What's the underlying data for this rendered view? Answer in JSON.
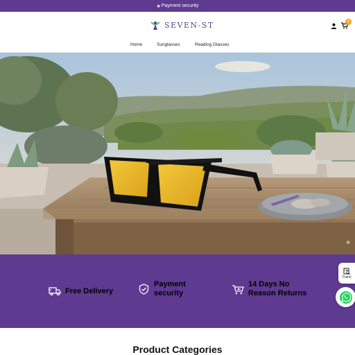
{
  "announcement": {
    "text": "Payment security",
    "icon": "star-icon"
  },
  "header": {
    "brand": "SEVEN-ST",
    "cart_count": "0",
    "icons": [
      "user-icon",
      "cart-icon"
    ]
  },
  "nav": {
    "items": [
      "Home",
      "Sunglasses",
      "Reading Glasses"
    ]
  },
  "hero": {
    "image": "yellow-tinted sunglasses on a wooden table in a mediterranean garden"
  },
  "features": [
    {
      "label": "Free Delivery",
      "icon": "delivery-truck-icon"
    },
    {
      "label": "Payment security",
      "icon": "shield-check-icon"
    },
    {
      "label": "14 Days No Reason Returns",
      "icon": "return-cart-icon"
    }
  ],
  "floating": {
    "track_label": "Track",
    "whatsapp_icon": "whatsapp-icon"
  },
  "categories": {
    "title": "Product Categories"
  },
  "colors": {
    "brand_purple": "#5e3a91",
    "badge": "#f2a01c",
    "whatsapp": "#25d366"
  }
}
